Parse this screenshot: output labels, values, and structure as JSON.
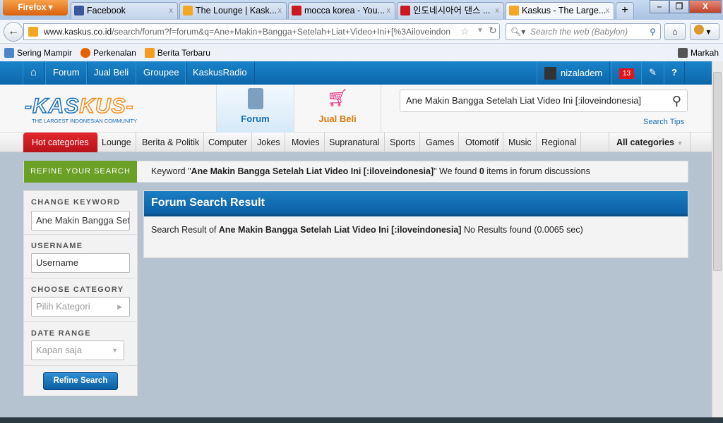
{
  "browser": {
    "menu_label": "Firefox ▾",
    "tabs": [
      {
        "title": "Facebook",
        "color": "#3b5998"
      },
      {
        "title": "The Lounge | Kask...",
        "color": "#f5a623"
      },
      {
        "title": "mocca korea - You...",
        "color": "#cc181e"
      },
      {
        "title": "인도네시아어 댄스 ...",
        "color": "#cc181e"
      },
      {
        "title": "Kaskus - The Large...",
        "color": "#f5a623"
      }
    ],
    "new_tab": "+",
    "url_domain": "www.kaskus.co.id",
    "url_path": "/search/forum?f=forum&q=Ane+Makin+Bangga+Setelah+Liat+Video+Ini+[%3Ailoveindon",
    "search_placeholder": "Search the web (Babylon)",
    "bookmarks": [
      "Sering Mampir",
      "Perkenalan",
      "Berita Terbaru"
    ],
    "bookmarks_right": "Markah"
  },
  "topnav": {
    "items": [
      "Forum",
      "Jual Beli",
      "Groupee",
      "KaskusRadio"
    ],
    "username": "nizaladem",
    "notifications": "13"
  },
  "header": {
    "logo": "KASKUS",
    "tagline": "THE LARGEST INDONESIAN COMMUNITY",
    "tabs": [
      "Forum",
      "Jual Beli"
    ],
    "search_value": "Ane Makin Bangga Setelah Liat Video Ini [:iloveindonesia]",
    "search_tips": "Search Tips"
  },
  "categories": {
    "hot": "Hot categories",
    "items": [
      "Lounge",
      "Berita & Politik",
      "Computer",
      "Jokes",
      "Movies",
      "Supranatural",
      "Sports",
      "Games",
      "Otomotif",
      "Music",
      "Regional"
    ],
    "all": "All categories"
  },
  "refine": {
    "tab": "REFINE YOUR SEARCH",
    "kw_prefix": "Keyword \"",
    "kw": "Ane Makin Bangga Setelah Liat Video Ini [:iloveindonesia]",
    "kw_mid": "\" We found ",
    "count": "0",
    "kw_suffix": " items in forum discussions"
  },
  "sidebar": {
    "keyword_label": "CHANGE KEYWORD",
    "keyword_value": "Ane Makin Bangga Setelah Liat Video Ini [:iloveindonesia]",
    "username_label": "USERNAME",
    "username_placeholder": "Username",
    "category_label": "CHOOSE CATEGORY",
    "category_value": "Pilih Kategori",
    "date_label": "DATE RANGE",
    "date_value": "Kapan saja",
    "button": "Refine Search"
  },
  "result": {
    "title": "Forum Search Result",
    "prefix": "Search Result of ",
    "query": "Ane Makin Bangga Setelah Liat Video Ini [:iloveindonesia]",
    "suffix": " No Results found (0.0065 sec)"
  }
}
